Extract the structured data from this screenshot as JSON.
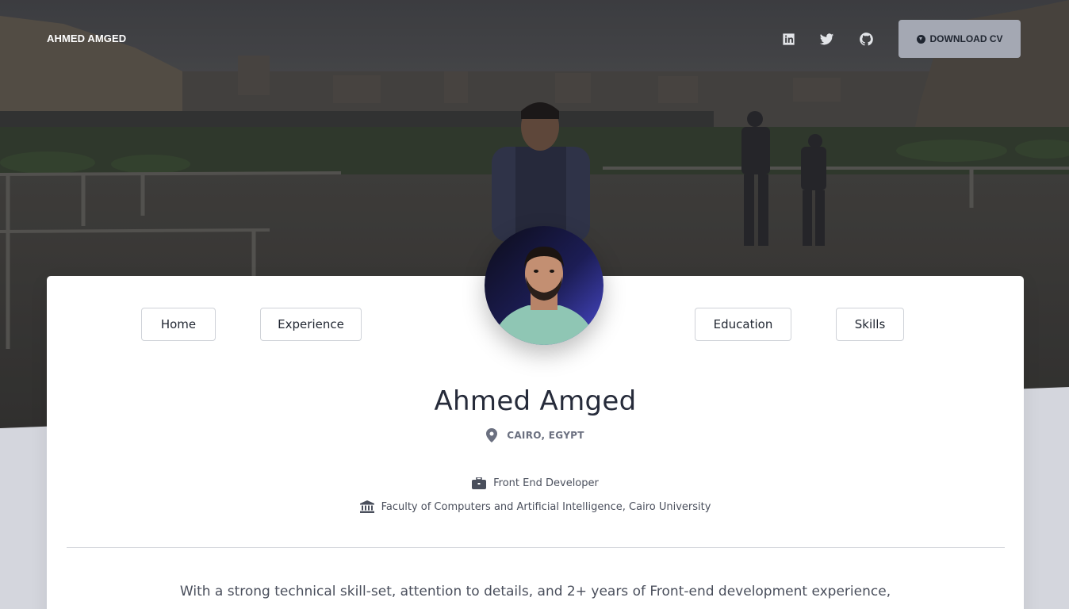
{
  "header": {
    "brand": "AHMED AMGED",
    "download_cv_label": "DOWNLOAD CV",
    "social": [
      "linkedin-icon",
      "twitter-icon",
      "github-icon"
    ]
  },
  "nav": {
    "home": "Home",
    "experience": "Experience",
    "education": "Education",
    "skills": "Skills"
  },
  "profile": {
    "name": "Ahmed Amged",
    "location": "CAIRO, EGYPT",
    "role": "Front End Developer",
    "institution": "Faculty of Computers and Artificial Intelligence, Cairo University",
    "bio": "With a strong technical skill-set, attention to details, and 2+ years of Front-end development experience,"
  },
  "colors": {
    "page_background": "#d4d6dd",
    "card": "#ffffff",
    "cv_button": "#a4a8b3",
    "text_dark": "#262b3a"
  }
}
